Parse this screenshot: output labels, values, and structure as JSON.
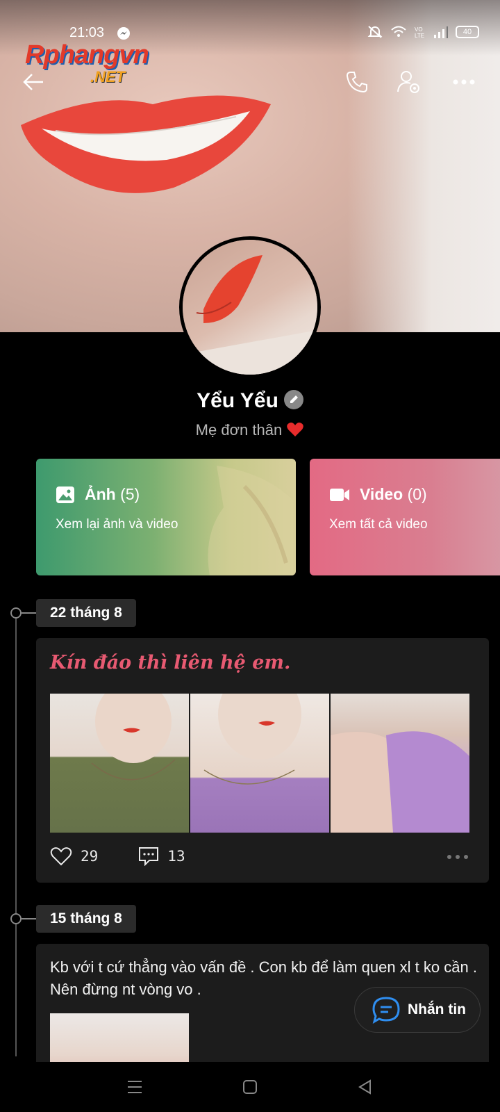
{
  "status": {
    "time": "21:03",
    "battery": "40"
  },
  "watermark": {
    "line1": "Rphangvn",
    "line2": ".NET"
  },
  "profile": {
    "name": "Yểu Yểu",
    "bio": "Mẹ đơn thân"
  },
  "cards": {
    "photos": {
      "label": "Ảnh",
      "count": "(5)",
      "sub": "Xem lại ảnh và video"
    },
    "videos": {
      "label": "Video",
      "count": "(0)",
      "sub": "Xem tất cả video"
    }
  },
  "posts": [
    {
      "date": "22 tháng 8",
      "caption": "Kín đáo thì liên hệ em.",
      "likes": "29",
      "comments": "13"
    },
    {
      "date": "15 tháng 8",
      "text": "Kb với t cứ thẳng vào vấn đề . Con kb để làm quen xl t ko cần . Nên đừng  nt vòng vo ."
    }
  ],
  "message_button": {
    "label": "Nhắn tin"
  },
  "colors": {
    "photos_card": "#3e9a6e",
    "videos_card": "#e36a84",
    "caption": "#e85a72",
    "message_icon": "#2f8ef0"
  }
}
